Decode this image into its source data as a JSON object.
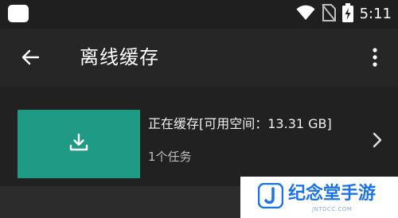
{
  "status_bar": {
    "time": "5:11",
    "icons": [
      "notification-square-icon",
      "wifi-icon",
      "no-sim-icon",
      "battery-charging-icon"
    ]
  },
  "app_bar": {
    "title": "离线缓存",
    "back_icon": "arrow-left-icon",
    "more_icon": "more-vert-icon"
  },
  "task": {
    "title": "正在缓存[可用空间：13.31 GB]",
    "subtitle": "1个任务",
    "thumbnail_icon": "download-icon",
    "thumbnail_color": "#1f9a85",
    "chevron_icon": "chevron-right-icon"
  },
  "watermark": {
    "text": "纪念堂手游",
    "subtext": "JNTDCC.COM",
    "color": "#1a73e8"
  }
}
